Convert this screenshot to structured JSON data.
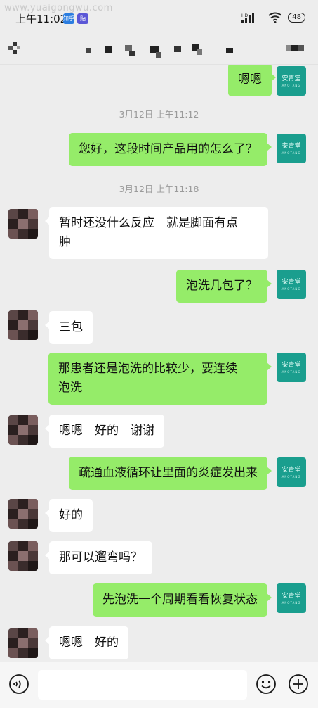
{
  "status_bar": {
    "watermark": "www.yuaigongwu.com",
    "time": "上午11:02",
    "app_badges": [
      "知乎",
      "贴"
    ],
    "network": "HD",
    "battery": "48"
  },
  "header": {
    "icons": {
      "back": "back-icon (pixelated)",
      "more": "more-icon (pixelated)"
    }
  },
  "messages": [
    {
      "type": "out",
      "text": "嗯嗯"
    },
    {
      "type": "time",
      "text": "3月12日 上午11:12"
    },
    {
      "type": "out",
      "text": "您好，这段时间产品用的怎么了？"
    },
    {
      "type": "time",
      "text": "3月12日 上午11:18"
    },
    {
      "type": "in",
      "lines": [
        "暂时还没什么反应　就是脚面有点",
        "肿"
      ]
    },
    {
      "type": "out",
      "text": "泡洗几包了？"
    },
    {
      "type": "in",
      "text": "三包"
    },
    {
      "type": "out",
      "lines": [
        "那患者还是泡洗的比较少，要连续",
        "泡洗"
      ]
    },
    {
      "type": "in",
      "text": "嗯嗯　好的　谢谢"
    },
    {
      "type": "out",
      "text": "疏通血液循环让里面的炎症发出来"
    },
    {
      "type": "in",
      "text": "好的"
    },
    {
      "type": "in",
      "text": "那可以遛弯吗？"
    },
    {
      "type": "out",
      "text": "先泡洗一个周期看看恢复状态"
    },
    {
      "type": "in",
      "text": "嗯嗯　好的"
    }
  ],
  "self_avatar": {
    "name_cn": "安青堂",
    "name_en": "ANQTANG"
  },
  "input_bar": {
    "placeholder": "",
    "value": ""
  },
  "colors": {
    "outgoing_bubble": "#95ec69",
    "incoming_bubble": "#ffffff",
    "background": "#ededed",
    "self_avatar": "#1a9e8e"
  }
}
